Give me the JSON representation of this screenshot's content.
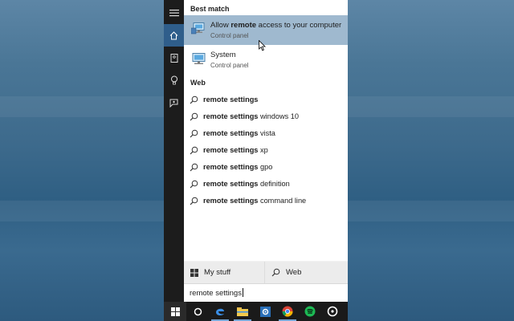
{
  "search_panel": {
    "best_match_label": "Best match",
    "best_match": [
      {
        "prefix": "Allow ",
        "bold": "remote",
        "suffix": " access to your computer",
        "subtitle": "Control panel",
        "icon": "monitor-icon",
        "highlighted": true
      },
      {
        "prefix": "System",
        "bold": "",
        "suffix": "",
        "subtitle": "Control panel",
        "icon": "monitor-icon",
        "highlighted": false
      }
    ],
    "web_label": "Web",
    "web_results": [
      {
        "bold": "remote settings",
        "suffix": ""
      },
      {
        "bold": "remote settings",
        "suffix": " windows 10"
      },
      {
        "bold": "remote settings",
        "suffix": " vista"
      },
      {
        "bold": "remote settings",
        "suffix": " xp"
      },
      {
        "bold": "remote settings",
        "suffix": " gpo"
      },
      {
        "bold": "remote settings",
        "suffix": " definition"
      },
      {
        "bold": "remote settings",
        "suffix": " command line"
      }
    ],
    "tabs": {
      "my_stuff": "My stuff",
      "web": "Web"
    },
    "search_box": {
      "value": "remote settings"
    }
  },
  "rail": {
    "items": [
      "hamburger-icon",
      "home-icon",
      "notebook-icon",
      "lightbulb-icon",
      "feedback-icon"
    ],
    "active": "home-icon"
  },
  "taskbar": {
    "items": [
      "windows-start-icon",
      "cortana-icon",
      "edge-icon",
      "file-explorer-icon",
      "settings-icon",
      "chrome-icon",
      "spotify-icon",
      "groove-icon"
    ]
  },
  "colors": {
    "highlight": "#9fb9cf",
    "rail_active": "#2f5e8b",
    "taskbar": "#1a1a1a"
  }
}
